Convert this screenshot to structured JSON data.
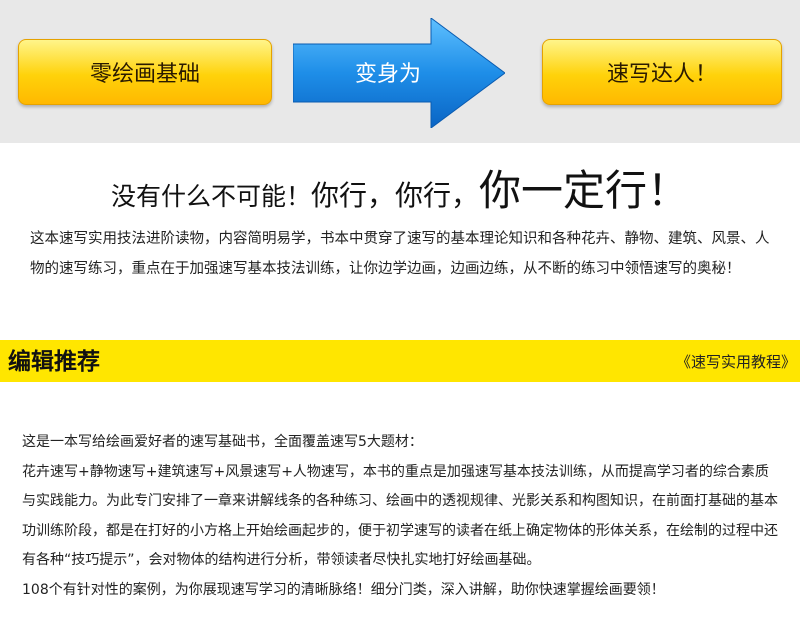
{
  "banner": {
    "left_box": "零绘画基础",
    "arrow_label": "变身为",
    "right_box": "速写达人！",
    "colors": {
      "band": "#e8e8e8",
      "box_yellow": "#ffd20a",
      "arrow_blue": "#1e8ee8"
    }
  },
  "headline": {
    "part1": "没有什么不可能！",
    "part2": "你行，你行，",
    "part3": "你一定行！"
  },
  "intro_text": "这本速写实用技法进阶读物，内容简明易学，书本中贯穿了速写的基本理论知识和各种花卉、静物、建筑、风景、人物的速写练习，重点在于加强速写基本技法训练，让你边学边画，边画边练，从不断的练习中领悟速写的奥秘！",
  "section": {
    "title": "编辑推荐",
    "book_title": "《速写实用教程》",
    "bar_color": "#ffe600"
  },
  "details": {
    "p1": "这是一本写给绘画爱好者的速写基础书，全面覆盖速写5大题材：",
    "p2": "花卉速写+静物速写+建筑速写+风景速写+人物速写，本书的重点是加强速写基本技法训练，从而提高学习者的综合素质与实践能力。为此专门安排了一章来讲解线条的各种练习、绘画中的透视规律、光影关系和构图知识，在前面打基础的基本功训练阶段，都是在打好的小方格上开始绘画起步的，便于初学速写的读者在纸上确定物体的形体关系，在绘制的过程中还有各种“技巧提示”，会对物体的结构进行分析，带领读者尽快扎实地打好绘画基础。",
    "p3": "108个有针对性的案例，为你展现速写学习的清晰脉络！细分门类，深入讲解，助你快速掌握绘画要领！"
  }
}
